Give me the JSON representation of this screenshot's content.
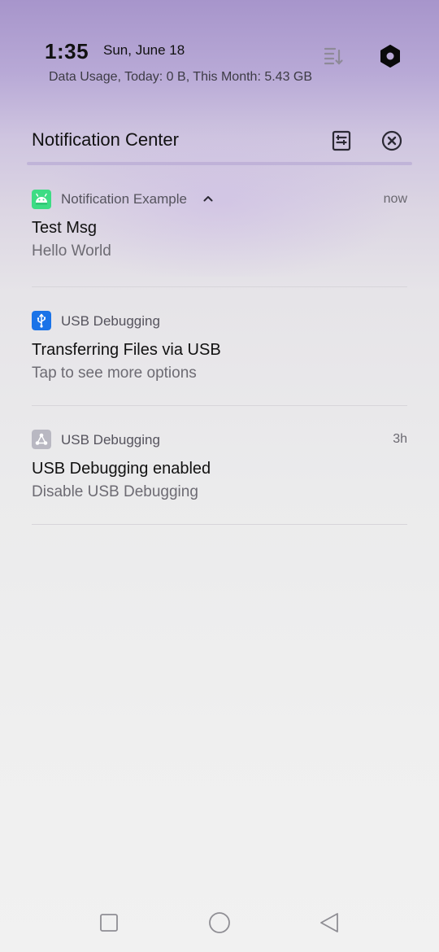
{
  "status": {
    "time": "1:35",
    "date": "Sun, June 18",
    "data_usage": "Data Usage, Today: 0 B, This Month: 5.43 GB"
  },
  "notification_center": {
    "title": "Notification Center"
  },
  "notifications": [
    {
      "app_name": "Notification Example",
      "time": "now",
      "title": "Test Msg",
      "body": "Hello World",
      "icon": "android-icon",
      "icon_color": "#3ddc84"
    },
    {
      "app_name": "USB Debugging",
      "time": "",
      "title": "Transferring Files via USB",
      "body": "Tap to see more options",
      "icon": "usb-icon",
      "icon_color": "#1a73e8"
    },
    {
      "app_name": "USB Debugging",
      "time": "3h",
      "title": "USB Debugging enabled",
      "body": "Disable USB Debugging",
      "icon": "debug-icon",
      "icon_color": "#b9b8c2"
    }
  ],
  "navigation": {
    "recents": "square-icon",
    "home": "circle-icon",
    "back": "triangle-icon"
  }
}
